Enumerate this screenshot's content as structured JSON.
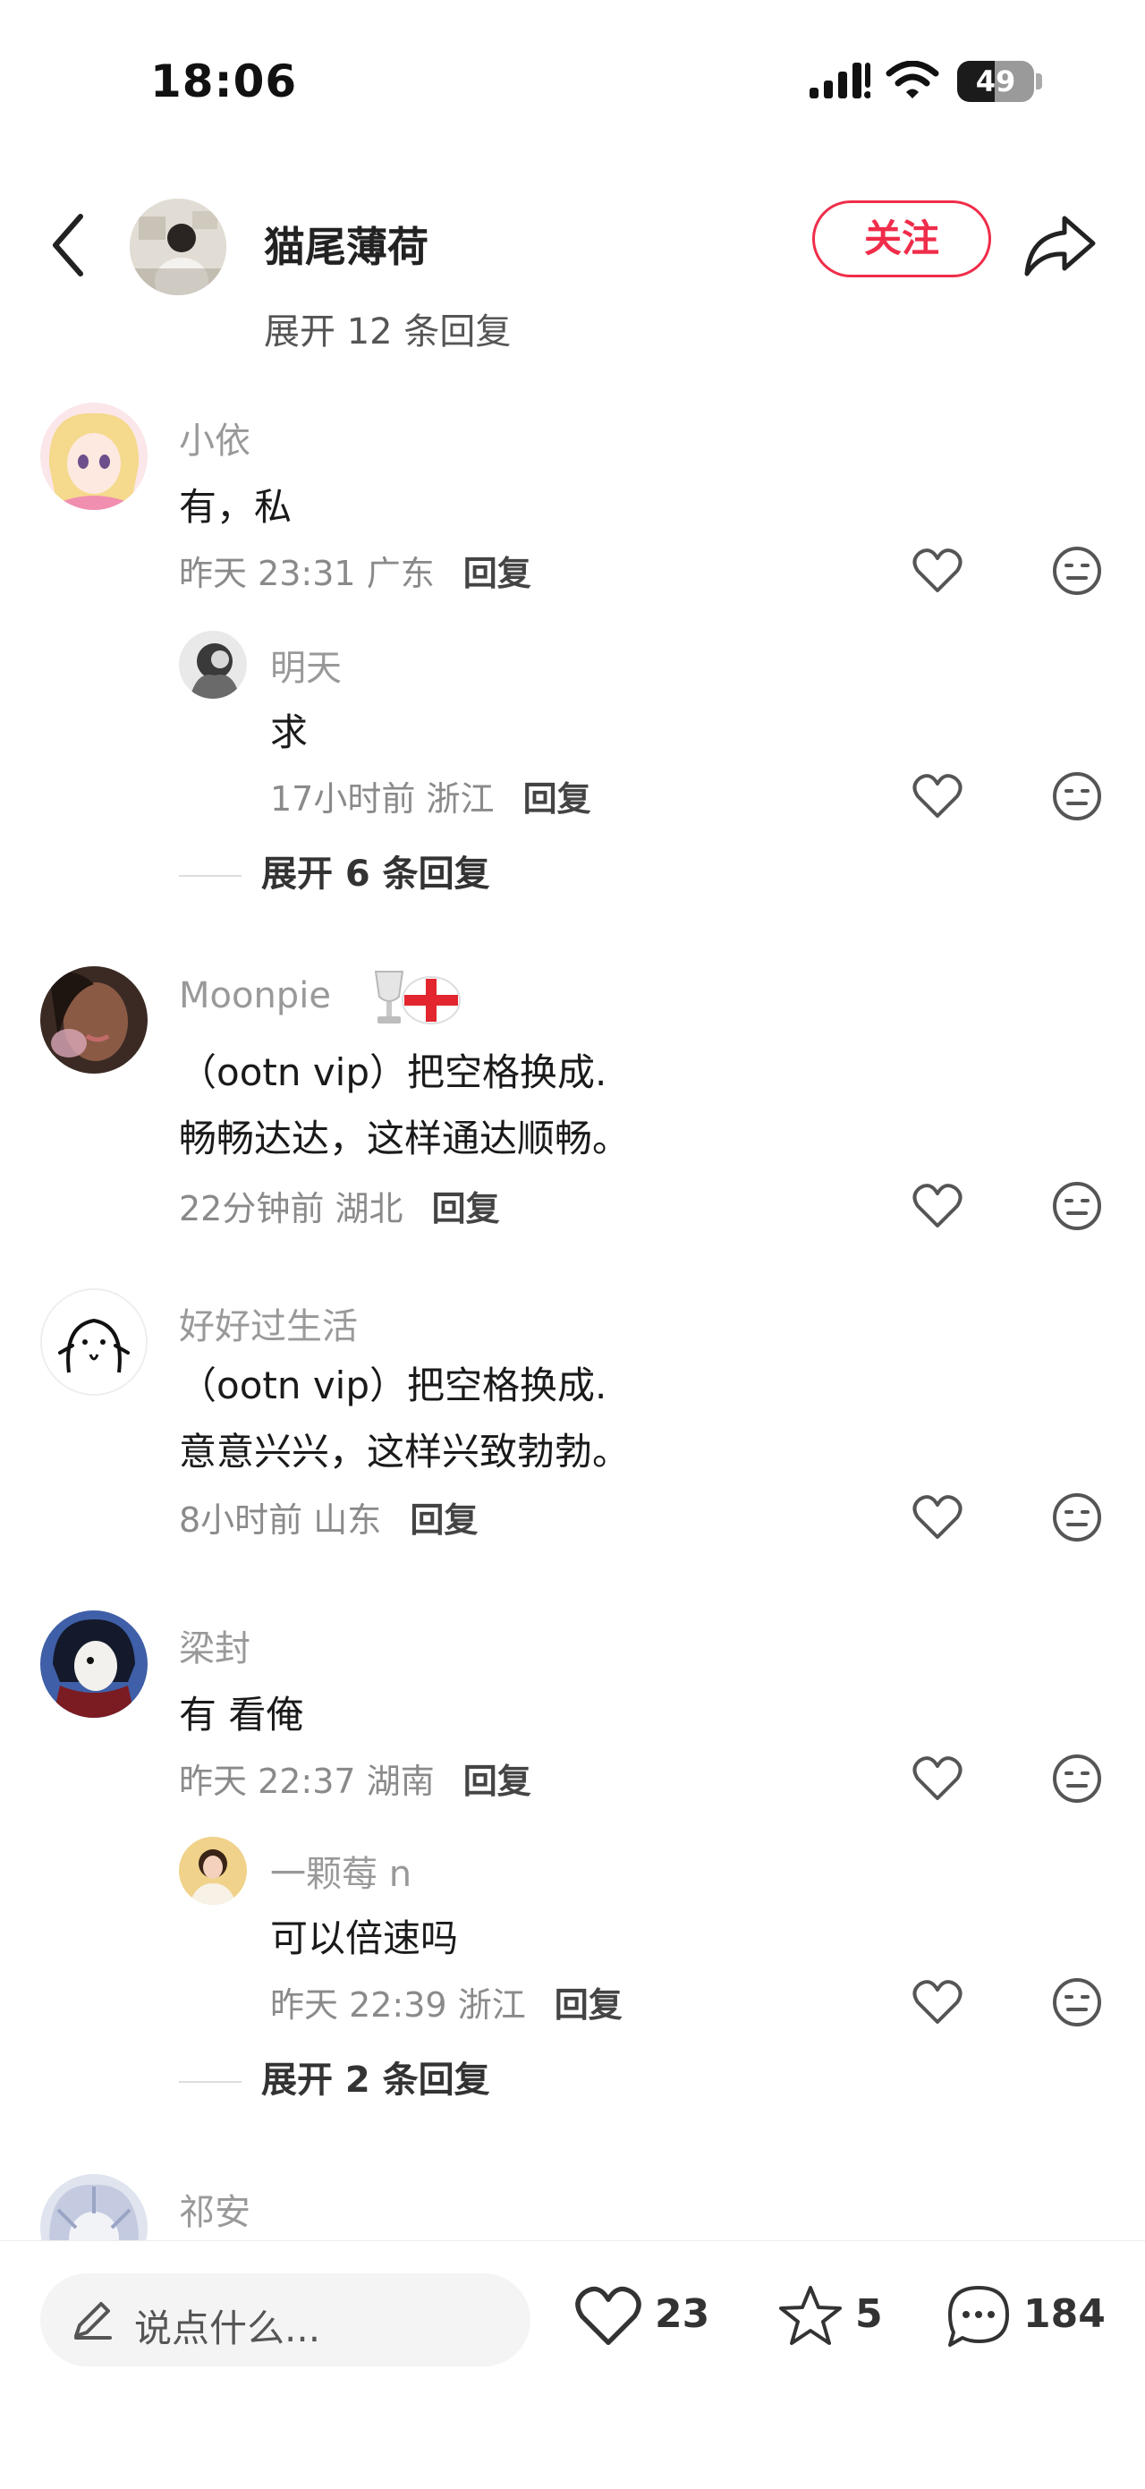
{
  "status_bar": {
    "time": "18:06",
    "battery": "49",
    "battery_level": 0.49
  },
  "header": {
    "author": "猫尾薄荷",
    "follow_label": "关注"
  },
  "cut_text": "展开 12 条回复",
  "comments": [
    {
      "user": "小依",
      "text": "有，私",
      "time": "昨天 23:31",
      "location": "广东",
      "reply_label": "回复",
      "replies": [
        {
          "user": "明天",
          "text": "求",
          "time": "17小时前",
          "location": "浙江",
          "reply_label": "回复"
        }
      ],
      "expand": "展开 6 条回复"
    },
    {
      "user": "Moonpie",
      "line1": "（ootn vip）把空格换成.",
      "line2": "畅畅达达，这样通达顺畅。",
      "time": "22分钟前",
      "location": "湖北",
      "reply_label": "回复"
    },
    {
      "user": "好好过生活",
      "line1": "（ootn vip）把空格换成.",
      "line2": "意意兴兴，这样兴致勃勃。",
      "time": "8小时前",
      "location": "山东",
      "reply_label": "回复"
    },
    {
      "user": "梁封",
      "text": "有 看俺",
      "time": "昨天 22:37",
      "location": "湖南",
      "reply_label": "回复",
      "replies": [
        {
          "user": "一颗莓 n",
          "text": "可以倍速吗",
          "time": "昨天 22:39",
          "location": "浙江",
          "reply_label": "回复"
        }
      ],
      "expand": "展开 2 条回复"
    },
    {
      "user": "祁安"
    }
  ],
  "bottom_bar": {
    "placeholder": "说点什么...",
    "likes": "23",
    "favorites": "5",
    "comments": "184"
  },
  "icons": {
    "back": "chevron-left-icon",
    "share": "share-arrow-icon",
    "like": "heart-icon",
    "dislike": "neutral-face-icon",
    "edit": "pencil-icon",
    "star": "star-icon",
    "comment": "chat-bubble-icon"
  },
  "colors": {
    "accent": "#ef2d4a",
    "muted_text": "#999999",
    "icon": "#555555"
  }
}
